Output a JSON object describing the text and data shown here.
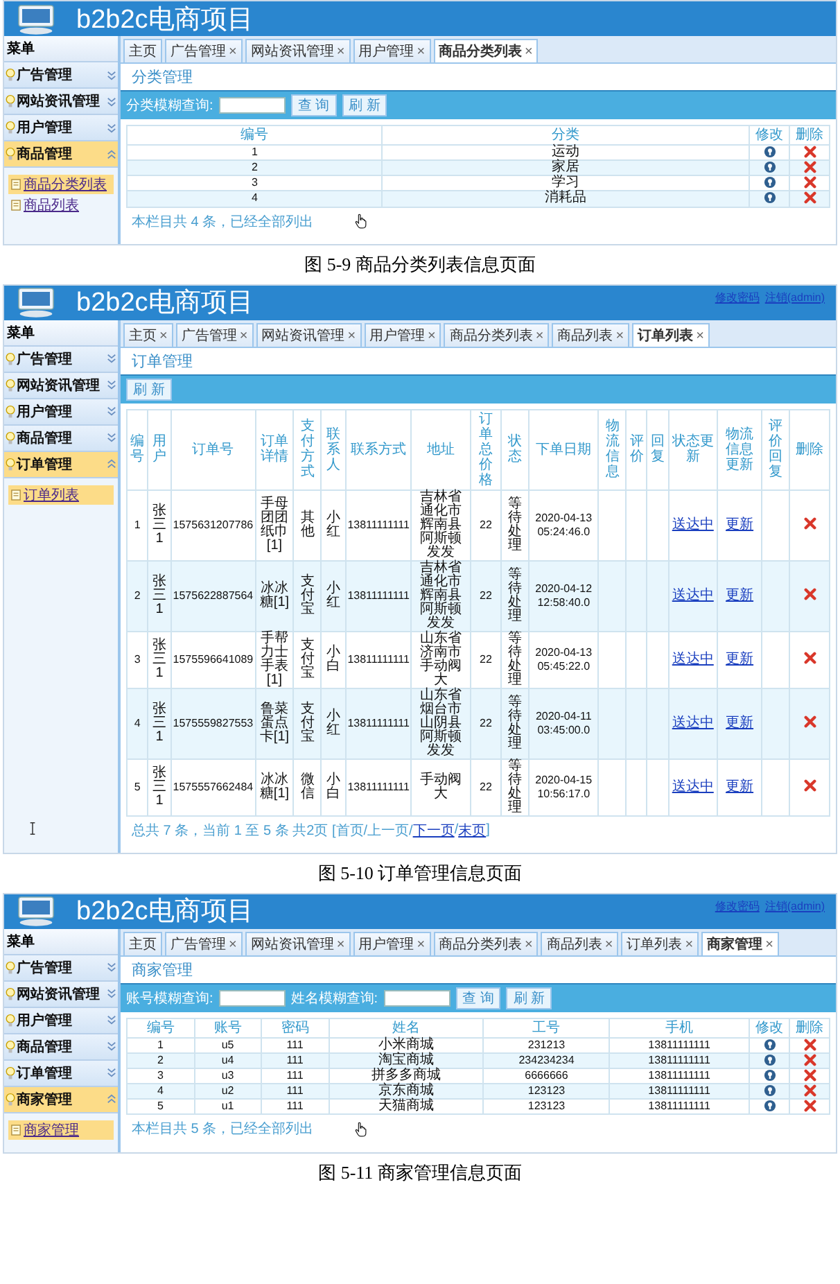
{
  "screens": [
    {
      "header": {
        "title": "b2b2c电商项目"
      },
      "menu_title": "菜单",
      "sidebar": [
        {
          "label": "广告管理",
          "expanded": false,
          "selected": false
        },
        {
          "label": "网站资讯管理",
          "expanded": false,
          "selected": false
        },
        {
          "label": "用户管理",
          "expanded": false,
          "selected": false
        },
        {
          "label": "商品管理",
          "expanded": true,
          "selected": true,
          "children": [
            {
              "label": "商品分类列表",
              "selected": true
            },
            {
              "label": "商品列表",
              "selected": false
            }
          ]
        }
      ],
      "tabs": [
        {
          "label": "主页",
          "selected": false
        },
        {
          "label": "广告管理",
          "close": "×",
          "selected": false
        },
        {
          "label": "网站资讯管理",
          "close": "×",
          "selected": false
        },
        {
          "label": "用户管理",
          "close": "×",
          "selected": false
        },
        {
          "label": "商品分类列表",
          "close": "×",
          "selected": true
        }
      ],
      "section_title": "分类管理",
      "toolbar": [
        {
          "kind": "label",
          "text": "分类模糊查询:"
        },
        {
          "kind": "input"
        },
        {
          "kind": "button",
          "text": "查 询"
        },
        {
          "kind": "button",
          "text": "刷 新"
        }
      ],
      "table": {
        "columns": [
          {
            "label": "编号",
            "kind": "num"
          },
          {
            "label": "分类",
            "kind": "text"
          },
          {
            "label": "修改",
            "kind": "edit"
          },
          {
            "label": "删除",
            "kind": "delete"
          }
        ],
        "rows": [
          [
            "1",
            "运动",
            null,
            null
          ],
          [
            "2",
            "家居",
            null,
            null
          ],
          [
            "3",
            "学习",
            null,
            null
          ],
          [
            "4",
            "消耗品",
            null,
            null
          ]
        ]
      },
      "footer": [
        {
          "text": "本栏目共 4 条，已经全部列出",
          "link": false
        }
      ],
      "hand_cursor": true,
      "caption": "图 5-9 商品分类列表信息页面"
    },
    {
      "header": {
        "title": "b2b2c电商项目",
        "links": [
          "修改密码",
          "注销(admin)"
        ]
      },
      "menu_title": "菜单",
      "sidebar": [
        {
          "label": "广告管理",
          "expanded": false,
          "selected": false
        },
        {
          "label": "网站资讯管理",
          "expanded": false,
          "selected": false
        },
        {
          "label": "用户管理",
          "expanded": false,
          "selected": false
        },
        {
          "label": "商品管理",
          "expanded": false,
          "selected": false
        },
        {
          "label": "订单管理",
          "expanded": true,
          "selected": true,
          "children": [
            {
              "label": "订单列表",
              "selected": true
            }
          ]
        }
      ],
      "tabs": [
        {
          "label": "主页",
          "close": "×",
          "selected": false
        },
        {
          "label": "广告管理",
          "close": "×",
          "selected": false
        },
        {
          "label": "网站资讯管理",
          "close": "×",
          "selected": false
        },
        {
          "label": "用户管理",
          "close": "×",
          "selected": false
        },
        {
          "label": "商品分类列表",
          "close": "×",
          "selected": false
        },
        {
          "label": "商品列表",
          "close": "×",
          "selected": false
        },
        {
          "label": "订单列表",
          "close": "×",
          "selected": true
        }
      ],
      "section_title": "订单管理",
      "toolbar": [
        {
          "kind": "button",
          "text": "刷 新"
        }
      ],
      "table": {
        "columns": [
          {
            "label": "编号",
            "kind": "num"
          },
          {
            "label": "用户",
            "kind": "text"
          },
          {
            "label": "订单号",
            "kind": "num"
          },
          {
            "label": "订单详情",
            "kind": "text"
          },
          {
            "label": "支付方式",
            "kind": "text"
          },
          {
            "label": "联系人",
            "kind": "text"
          },
          {
            "label": "联系方式",
            "kind": "num"
          },
          {
            "label": "地址",
            "kind": "text"
          },
          {
            "label": "订单总价格",
            "kind": "num"
          },
          {
            "label": "状态",
            "kind": "text"
          },
          {
            "label": "下单日期",
            "kind": "num"
          },
          {
            "label": "物流信息",
            "kind": "text"
          },
          {
            "label": "评价",
            "kind": "text"
          },
          {
            "label": "回复",
            "kind": "text"
          },
          {
            "label": "状态更新",
            "kind": "link"
          },
          {
            "label": "物流信息更新",
            "kind": "link"
          },
          {
            "label": "评价回复",
            "kind": "text"
          },
          {
            "label": "删除",
            "kind": "delete"
          }
        ],
        "rows": [
          [
            "1",
            "张三1",
            "1575631207786",
            "手母团团纸巾[1]",
            "其他",
            "小红",
            "13811111111",
            "吉林省通化市辉南县阿斯顿发发",
            "22",
            "等待处理",
            "2020-04-13 05:24:46.0",
            null,
            null,
            null,
            "送达中",
            "更新",
            null,
            null
          ],
          [
            "2",
            "张三1",
            "1575622887564",
            "冰冰糖[1]",
            "支付宝",
            "小红",
            "13811111111",
            "吉林省通化市辉南县阿斯顿发发",
            "22",
            "等待处理",
            "2020-04-12 12:58:40.0",
            null,
            null,
            null,
            "送达中",
            "更新",
            null,
            null
          ],
          [
            "3",
            "张三1",
            "1575596641089",
            "手帮力士手表[1]",
            "支付宝",
            "小白",
            "13811111111",
            "山东省济南市手动阀大",
            "22",
            "等待处理",
            "2020-04-13 05:45:22.0",
            null,
            null,
            null,
            "送达中",
            "更新",
            null,
            null
          ],
          [
            "4",
            "张三1",
            "1575559827553",
            "鲁菜蛋点卡[1]",
            "支付宝",
            "小红",
            "13811111111",
            "山东省烟台市山阴县阿斯顿发发",
            "22",
            "等待处理",
            "2020-04-11 03:45:00.0",
            null,
            null,
            null,
            "送达中",
            "更新",
            null,
            null
          ],
          [
            "5",
            "张三1",
            "1575557662484",
            "冰冰糖[1]",
            "微信",
            "小白",
            "13811111111",
            "手动阀大",
            "22",
            "等待处理",
            "2020-04-15 10:56:17.0",
            null,
            null,
            null,
            "送达中",
            "更新",
            null,
            null
          ]
        ]
      },
      "footer": [
        {
          "text": "总共 7 条，当前 1 至 5 条 共2页 [首页/上一页/",
          "link": false
        },
        {
          "text": "下一页",
          "link": true
        },
        {
          "text": "/",
          "link": false
        },
        {
          "text": "末页",
          "link": true
        },
        {
          "text": "]",
          "link": false
        }
      ],
      "text_cursor": true,
      "caption": "图 5-10 订单管理信息页面"
    },
    {
      "header": {
        "title": "b2b2c电商项目",
        "links": [
          "修改密码",
          "注销(admin)"
        ]
      },
      "menu_title": "菜单",
      "sidebar": [
        {
          "label": "广告管理",
          "expanded": false,
          "selected": false
        },
        {
          "label": "网站资讯管理",
          "expanded": false,
          "selected": false
        },
        {
          "label": "用户管理",
          "expanded": false,
          "selected": false
        },
        {
          "label": "商品管理",
          "expanded": false,
          "selected": false
        },
        {
          "label": "订单管理",
          "expanded": false,
          "selected": false
        },
        {
          "label": "商家管理",
          "expanded": true,
          "selected": true,
          "children": [
            {
              "label": "商家管理",
              "selected": true
            }
          ]
        }
      ],
      "tabs": [
        {
          "label": "主页",
          "selected": false
        },
        {
          "label": "广告管理",
          "close": "×",
          "selected": false
        },
        {
          "label": "网站资讯管理",
          "close": "×",
          "selected": false
        },
        {
          "label": "用户管理",
          "close": "×",
          "selected": false
        },
        {
          "label": "商品分类列表",
          "close": "×",
          "selected": false
        },
        {
          "label": "商品列表",
          "close": "×",
          "selected": false
        },
        {
          "label": "订单列表",
          "close": "×",
          "selected": false
        },
        {
          "label": "商家管理",
          "close": "×",
          "selected": true
        }
      ],
      "section_title": "商家管理",
      "toolbar": [
        {
          "kind": "label",
          "text": "账号模糊查询:"
        },
        {
          "kind": "input"
        },
        {
          "kind": "label",
          "text": "姓名模糊查询:"
        },
        {
          "kind": "input"
        },
        {
          "kind": "button",
          "text": "查 询"
        },
        {
          "kind": "button",
          "text": "刷 新"
        }
      ],
      "table": {
        "columns": [
          {
            "label": "编号",
            "kind": "num"
          },
          {
            "label": "账号",
            "kind": "num"
          },
          {
            "label": "密码",
            "kind": "num"
          },
          {
            "label": "姓名",
            "kind": "text"
          },
          {
            "label": "工号",
            "kind": "num"
          },
          {
            "label": "手机",
            "kind": "num"
          },
          {
            "label": "修改",
            "kind": "edit"
          },
          {
            "label": "删除",
            "kind": "delete"
          }
        ],
        "rows": [
          [
            "1",
            "u5",
            "111",
            "小米商城",
            "231213",
            "13811111111",
            null,
            null
          ],
          [
            "2",
            "u4",
            "111",
            "淘宝商城",
            "234234234",
            "13811111111",
            null,
            null
          ],
          [
            "3",
            "u3",
            "111",
            "拼多多商城",
            "6666666",
            "13811111111",
            null,
            null
          ],
          [
            "4",
            "u2",
            "111",
            "京东商城",
            "123123",
            "13811111111",
            null,
            null
          ],
          [
            "5",
            "u1",
            "111",
            "天猫商城",
            "123123",
            "13811111111",
            null,
            null
          ]
        ]
      },
      "footer": [
        {
          "text": "本栏目共 5 条，已经全部列出",
          "link": false
        }
      ],
      "hand_cursor": true,
      "caption": "图 5-11 商家管理信息页面"
    }
  ]
}
